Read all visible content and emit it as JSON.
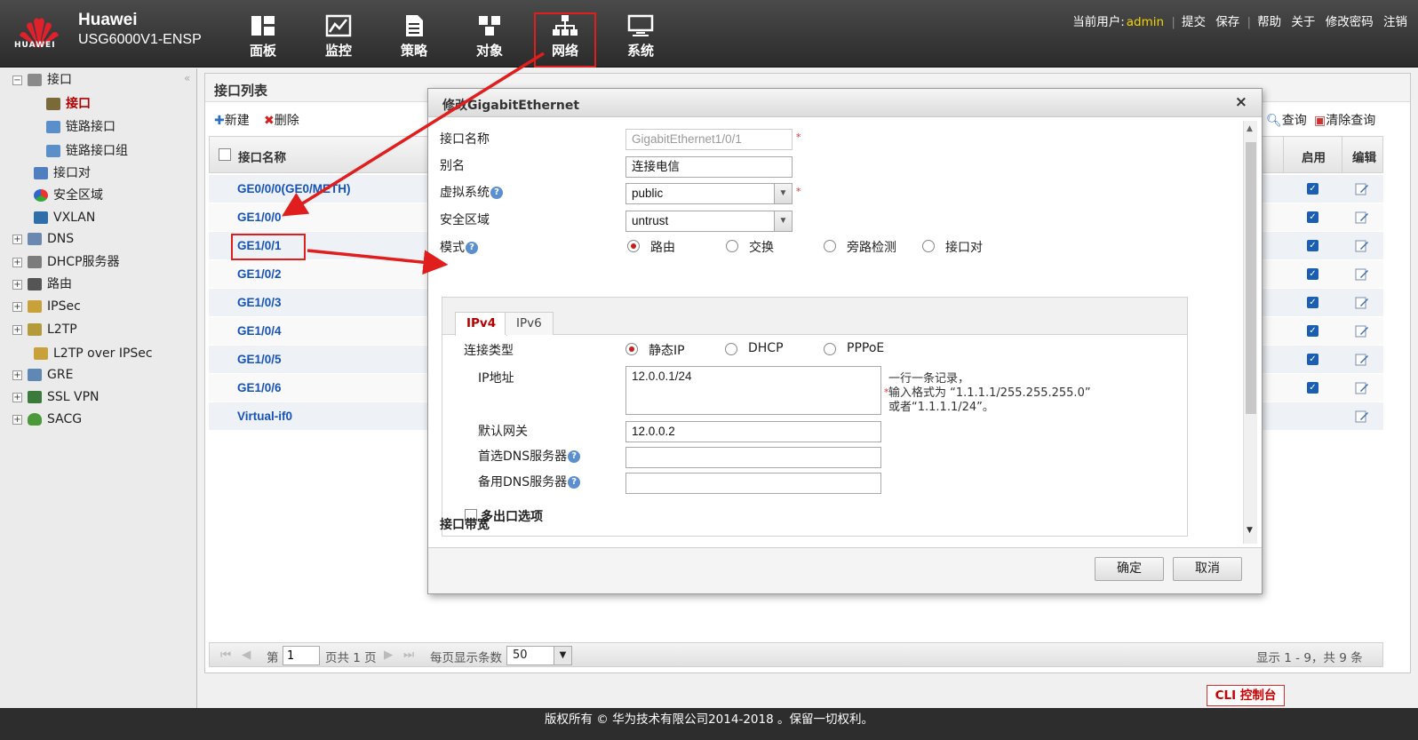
{
  "header": {
    "brand_name": "Huawei",
    "brand_model": "USG6000V1-ENSP",
    "logo_text": "HUAWEI",
    "nav": [
      {
        "label": "面板",
        "icon": "dashboard-icon"
      },
      {
        "label": "监控",
        "icon": "monitor-icon"
      },
      {
        "label": "策略",
        "icon": "policy-icon"
      },
      {
        "label": "对象",
        "icon": "object-icon"
      },
      {
        "label": "网络",
        "icon": "network-icon",
        "active": true
      },
      {
        "label": "系统",
        "icon": "system-icon"
      }
    ],
    "current_user_label": "当前用户:",
    "current_user": "admin",
    "links": [
      "提交",
      "保存",
      "帮助",
      "关于",
      "修改密码",
      "注销"
    ]
  },
  "sidebar": {
    "items": [
      {
        "label": "接口",
        "expander": "−",
        "icon": "interface-folder-icon"
      },
      {
        "label": "接口",
        "icon": "interface-icon",
        "selected": true
      },
      {
        "label": "链路接口",
        "icon": "link-interface-icon"
      },
      {
        "label": "链路接口组",
        "icon": "link-group-icon"
      },
      {
        "label": "接口对",
        "icon": "interface-pair-icon"
      },
      {
        "label": "安全区域",
        "icon": "security-zone-icon"
      },
      {
        "label": "VXLAN",
        "icon": "vxlan-icon"
      },
      {
        "label": "DNS",
        "expander": "+",
        "icon": "dns-icon"
      },
      {
        "label": "DHCP服务器",
        "expander": "+",
        "icon": "dhcp-icon"
      },
      {
        "label": "路由",
        "expander": "+",
        "icon": "route-icon"
      },
      {
        "label": "IPSec",
        "expander": "+",
        "icon": "ipsec-icon"
      },
      {
        "label": "L2TP",
        "expander": "+",
        "icon": "l2tp-icon"
      },
      {
        "label": "L2TP over IPSec",
        "icon": "l2tp-ipsec-icon"
      },
      {
        "label": "GRE",
        "expander": "+",
        "icon": "gre-icon"
      },
      {
        "label": "SSL VPN",
        "expander": "+",
        "icon": "sslvpn-icon"
      },
      {
        "label": "SACG",
        "expander": "+",
        "icon": "sacg-icon"
      }
    ]
  },
  "main": {
    "title": "接口列表",
    "toolbar": {
      "new": "新建",
      "delete": "删除",
      "query": "查询",
      "clear_query": "清除查询"
    },
    "columns": {
      "name": "接口名称",
      "enabled": "启用",
      "edit": "编辑"
    },
    "rows": [
      {
        "name": "GE0/0/0(GE0/METH)",
        "enabled": true
      },
      {
        "name": "GE1/0/0",
        "enabled": true
      },
      {
        "name": "GE1/0/1",
        "enabled": true
      },
      {
        "name": "GE1/0/2",
        "enabled": true
      },
      {
        "name": "GE1/0/3",
        "enabled": true
      },
      {
        "name": "GE1/0/4",
        "enabled": true
      },
      {
        "name": "GE1/0/5",
        "enabled": true
      },
      {
        "name": "GE1/0/6",
        "enabled": true
      },
      {
        "name": "Virtual-if0",
        "enabled": false
      }
    ],
    "pager": {
      "page_prefix": "第",
      "page_value": "1",
      "page_suffix": "页共 1 页",
      "per_page_label": "每页显示条数",
      "per_page_value": "50",
      "summary": "显示 1 - 9，共 9 条"
    }
  },
  "cli_button": "CLI 控制台",
  "footer": "版权所有 © 华为技术有限公司2014-2018 。保留一切权利。",
  "modal": {
    "title": "修改GigabitEthernet",
    "close": "×",
    "fields": {
      "name_label": "接口名称",
      "name_value": "GigabitEthernet1/0/1",
      "alias_label": "别名",
      "alias_value": "连接电信",
      "vsys_label": "虚拟系统",
      "vsys_value": "public",
      "zone_label": "安全区域",
      "zone_value": "untrust",
      "mode_label": "模式",
      "mode_options": [
        "路由",
        "交换",
        "旁路检测",
        "接口对"
      ],
      "mode_selected": "路由"
    },
    "tabs": [
      "IPv4",
      "IPv6"
    ],
    "ipv4": {
      "conn_type_label": "连接类型",
      "conn_options": [
        "静态IP",
        "DHCP",
        "PPPoE"
      ],
      "conn_selected": "静态IP",
      "ip_label": "IP地址",
      "ip_value": "12.0.0.1/24",
      "hint_line1": "一行一条记录，",
      "hint_line2": "输入格式为 “1.1.1.1/255.255.255.0”",
      "hint_line3": "或者“1.1.1.1/24”。",
      "gateway_label": "默认网关",
      "gateway_value": "12.0.0.2",
      "dns1_label": "首选DNS服务器",
      "dns1_value": "",
      "dns2_label": "备用DNS服务器",
      "dns2_value": "",
      "multi_exit_label": "多出口选项"
    },
    "bandwidth_label": "接口带宽",
    "ok": "确定",
    "cancel": "取消"
  },
  "colors": {
    "accent_red": "#e01e1e",
    "link_blue": "#1553b8",
    "user_yellow": "#f2d500"
  }
}
